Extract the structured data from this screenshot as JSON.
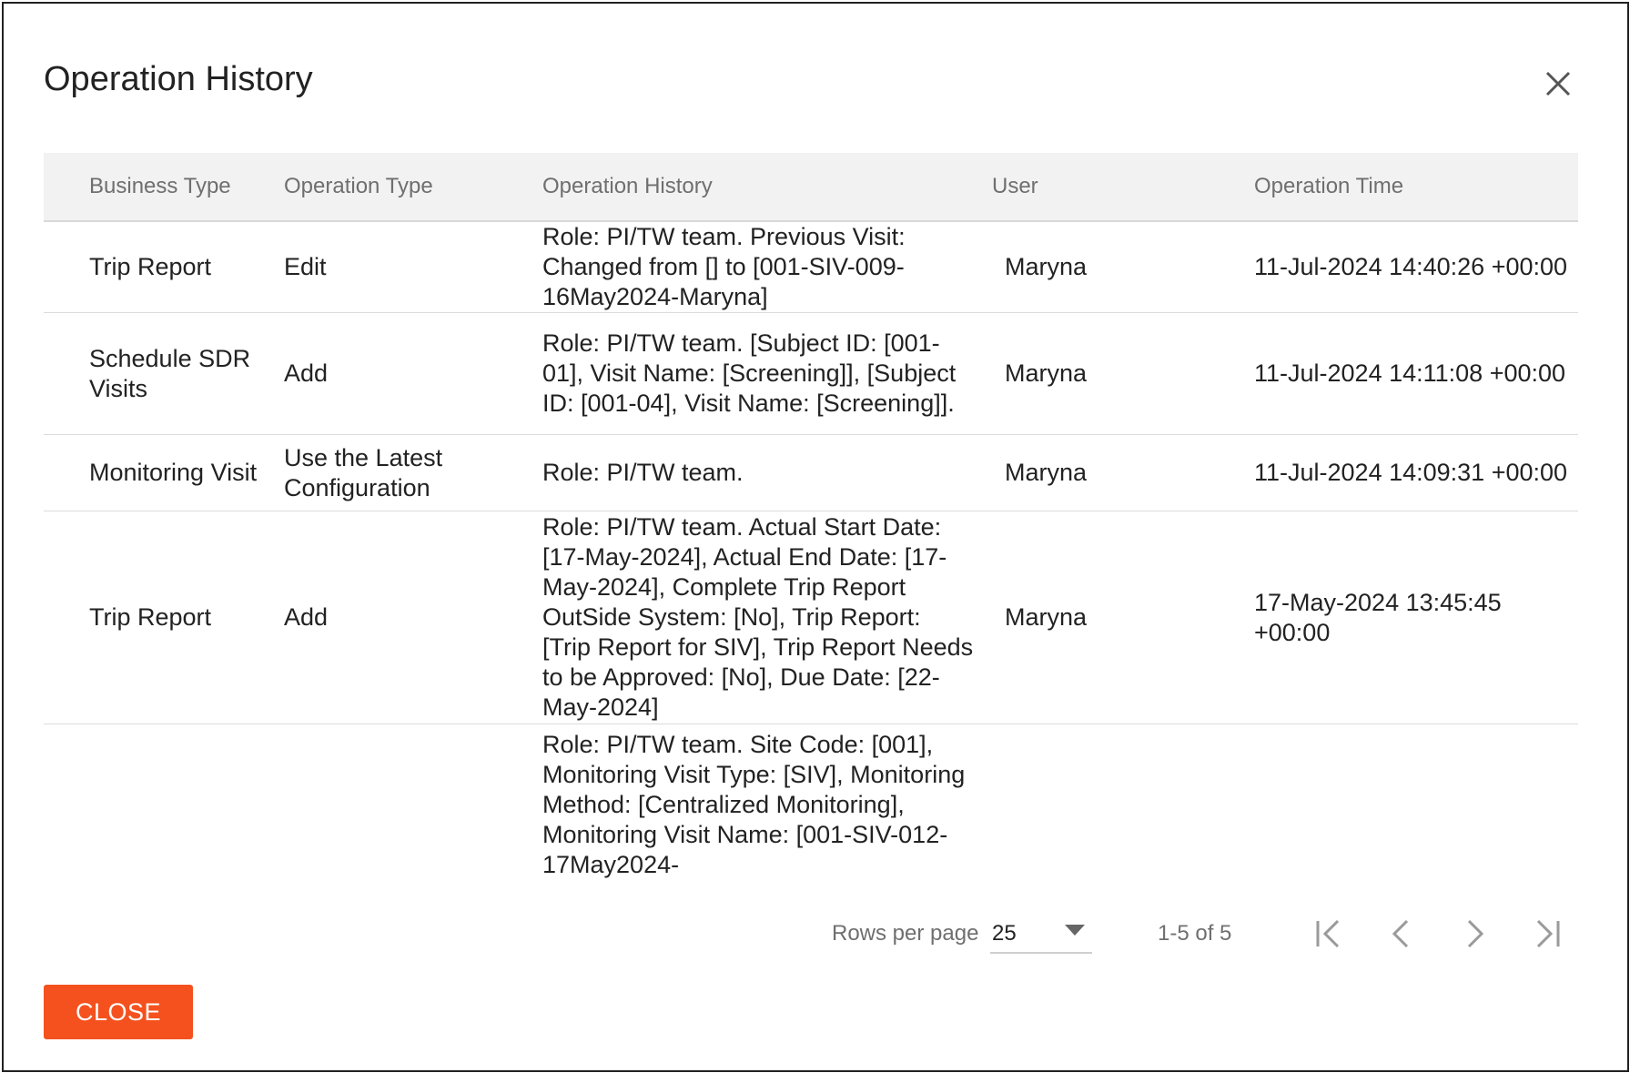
{
  "dialog": {
    "title": "Operation History",
    "close_icon": "close-icon",
    "close_button_label": "CLOSE"
  },
  "table": {
    "headers": [
      "Business Type",
      "Operation Type",
      "Operation History",
      "User",
      "Operation Time"
    ],
    "rows": [
      {
        "business_type": "Trip Report",
        "operation_type": "Edit",
        "operation_history": "Role: PI/TW team. Previous Visit: Changed from [] to [001-SIV-009-16May2024-Maryna]",
        "user": "Maryna",
        "operation_time": "11-Jul-2024 14:40:26 +00:00"
      },
      {
        "business_type": "Schedule SDR Visits",
        "operation_type": "Add",
        "operation_history": "Role: PI/TW team. [Subject ID: [001-01], Visit Name: [Screening]], [Subject ID: [001-04], Visit Name: [Screening]].",
        "user": "Maryna",
        "operation_time": "11-Jul-2024 14:11:08 +00:00"
      },
      {
        "business_type": "Monitoring Visit",
        "operation_type": "Use the Latest Configuration",
        "operation_history": "Role: PI/TW team.",
        "user": "Maryna",
        "operation_time": "11-Jul-2024 14:09:31 +00:00"
      },
      {
        "business_type": "Trip Report",
        "operation_type": "Add",
        "operation_history": "Role: PI/TW team. Actual Start Date: [17-May-2024], Actual End Date: [17-May-2024], Complete Trip Report OutSide System: [No], Trip Report: [Trip Report for SIV], Trip Report Needs to be Approved: [No], Due Date: [22-May-2024]",
        "user": "Maryna",
        "operation_time": "17-May-2024 13:45:45 +00:00"
      },
      {
        "business_type": "",
        "operation_type": "",
        "operation_history": "Role: PI/TW team. Site Code: [001], Monitoring Visit Type: [SIV], Monitoring Method: [Centralized Monitoring], Monitoring Visit Name: [001-SIV-012-17May2024-",
        "user": "",
        "operation_time": ""
      }
    ]
  },
  "pagination": {
    "rows_per_page_label": "Rows per page",
    "rows_per_page_value": "25",
    "range_text": "1-5 of 5",
    "first_icon": "first-page-icon",
    "prev_icon": "chevron-left-icon",
    "next_icon": "chevron-right-icon",
    "last_icon": "last-page-icon"
  }
}
